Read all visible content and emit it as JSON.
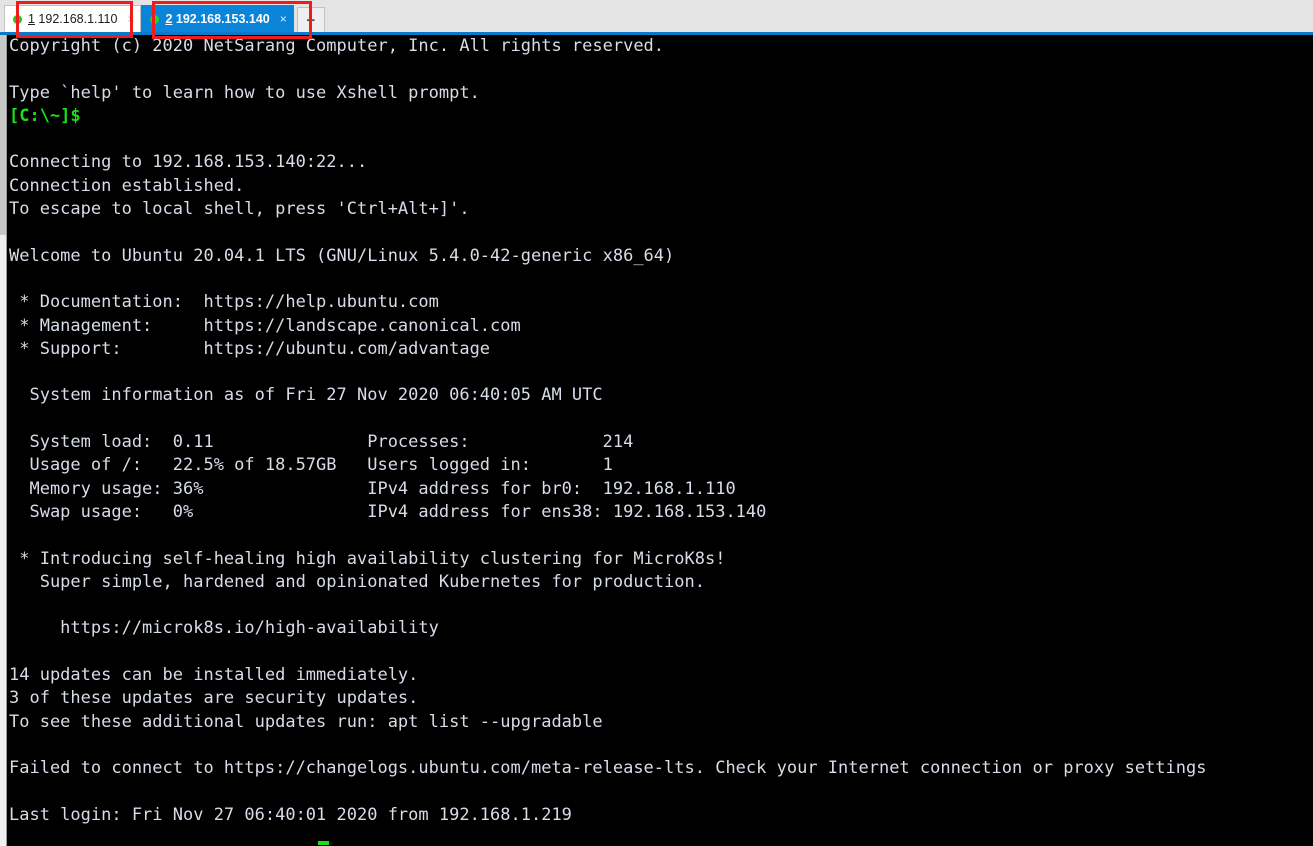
{
  "app": {
    "name": "Xshell",
    "accent_blue": "#0a7ac8",
    "tabbar_bg": "#e4e4e4",
    "terminal_bg": "#000000",
    "terminal_fg": "#d4d8e4",
    "prompt_green": "#18e018",
    "annotation_color": "#ee1c1c"
  },
  "tabbar": {
    "tabs": [
      {
        "index": "1",
        "title": "192.168.1.110",
        "full_label": "1 192.168.1.110",
        "active": false,
        "status": "connected",
        "close_label": "×"
      },
      {
        "index": "2",
        "title": "192.168.153.140",
        "full_label": "2 192.168.153.140",
        "active": true,
        "status": "connected",
        "close_label": "×"
      }
    ],
    "new_tab_label": "+"
  },
  "terminal": {
    "lines": [
      {
        "text": "Copyright (c) 2020 NetSarang Computer, Inc. All rights reserved.",
        "color": "white"
      },
      {
        "text": "",
        "color": "white"
      },
      {
        "text": "Type `help' to learn how to use Xshell prompt.",
        "color": "white"
      },
      {
        "text": "[C:\\~]$",
        "color": "green"
      },
      {
        "text": "",
        "color": "white"
      },
      {
        "text": "Connecting to 192.168.153.140:22...",
        "color": "white"
      },
      {
        "text": "Connection established.",
        "color": "white"
      },
      {
        "text": "To escape to local shell, press 'Ctrl+Alt+]'.",
        "color": "white"
      },
      {
        "text": "",
        "color": "white"
      },
      {
        "text": "Welcome to Ubuntu 20.04.1 LTS (GNU/Linux 5.4.0-42-generic x86_64)",
        "color": "white"
      },
      {
        "text": "",
        "color": "white"
      },
      {
        "text": " * Documentation:  https://help.ubuntu.com",
        "color": "white"
      },
      {
        "text": " * Management:     https://landscape.canonical.com",
        "color": "white"
      },
      {
        "text": " * Support:        https://ubuntu.com/advantage",
        "color": "white"
      },
      {
        "text": "",
        "color": "white"
      },
      {
        "text": "  System information as of Fri 27 Nov 2020 06:40:05 AM UTC",
        "color": "white"
      },
      {
        "text": "",
        "color": "white"
      },
      {
        "text": "  System load:  0.11               Processes:             214",
        "color": "white"
      },
      {
        "text": "  Usage of /:   22.5% of 18.57GB   Users logged in:       1",
        "color": "white"
      },
      {
        "text": "  Memory usage: 36%                IPv4 address for br0:  192.168.1.110",
        "color": "white"
      },
      {
        "text": "  Swap usage:   0%                 IPv4 address for ens38: 192.168.153.140",
        "color": "white"
      },
      {
        "text": "",
        "color": "white"
      },
      {
        "text": " * Introducing self-healing high availability clustering for MicroK8s!",
        "color": "white"
      },
      {
        "text": "   Super simple, hardened and opinionated Kubernetes for production.",
        "color": "white"
      },
      {
        "text": "",
        "color": "white"
      },
      {
        "text": "     https://microk8s.io/high-availability",
        "color": "white"
      },
      {
        "text": "",
        "color": "white"
      },
      {
        "text": "14 updates can be installed immediately.",
        "color": "white"
      },
      {
        "text": "3 of these updates are security updates.",
        "color": "white"
      },
      {
        "text": "To see these additional updates run: apt list --upgradable",
        "color": "white"
      },
      {
        "text": "",
        "color": "white"
      },
      {
        "text": "Failed to connect to https://changelogs.ubuntu.com/meta-release-lts. Check your Internet connection or proxy settings",
        "color": "white"
      },
      {
        "text": "",
        "color": "white"
      },
      {
        "text": "Last login: Fri Nov 27 06:40:01 2020 from 192.168.1.219",
        "color": "white"
      }
    ],
    "system_info": {
      "heading": "System information as of Fri 27 Nov 2020 06:40:05 AM UTC",
      "system_load": "0.11",
      "usage_of_root": "22.5% of 18.57GB",
      "memory_usage": "36%",
      "swap_usage": "0%",
      "processes": "214",
      "users_logged_in": "1",
      "ipv4_br0": "192.168.1.110",
      "ipv4_ens38": "192.168.153.140"
    },
    "updates": {
      "immediate": "14",
      "security": "3"
    },
    "last_login": "Fri Nov 27 06:40:01 2020 from 192.168.1.219",
    "cursor_visible": true
  },
  "annotations": [
    {
      "name": "tab-1-highlight",
      "target": "192.168.1.110"
    },
    {
      "name": "tab-2-highlight",
      "target": "192.168.153.140"
    }
  ]
}
